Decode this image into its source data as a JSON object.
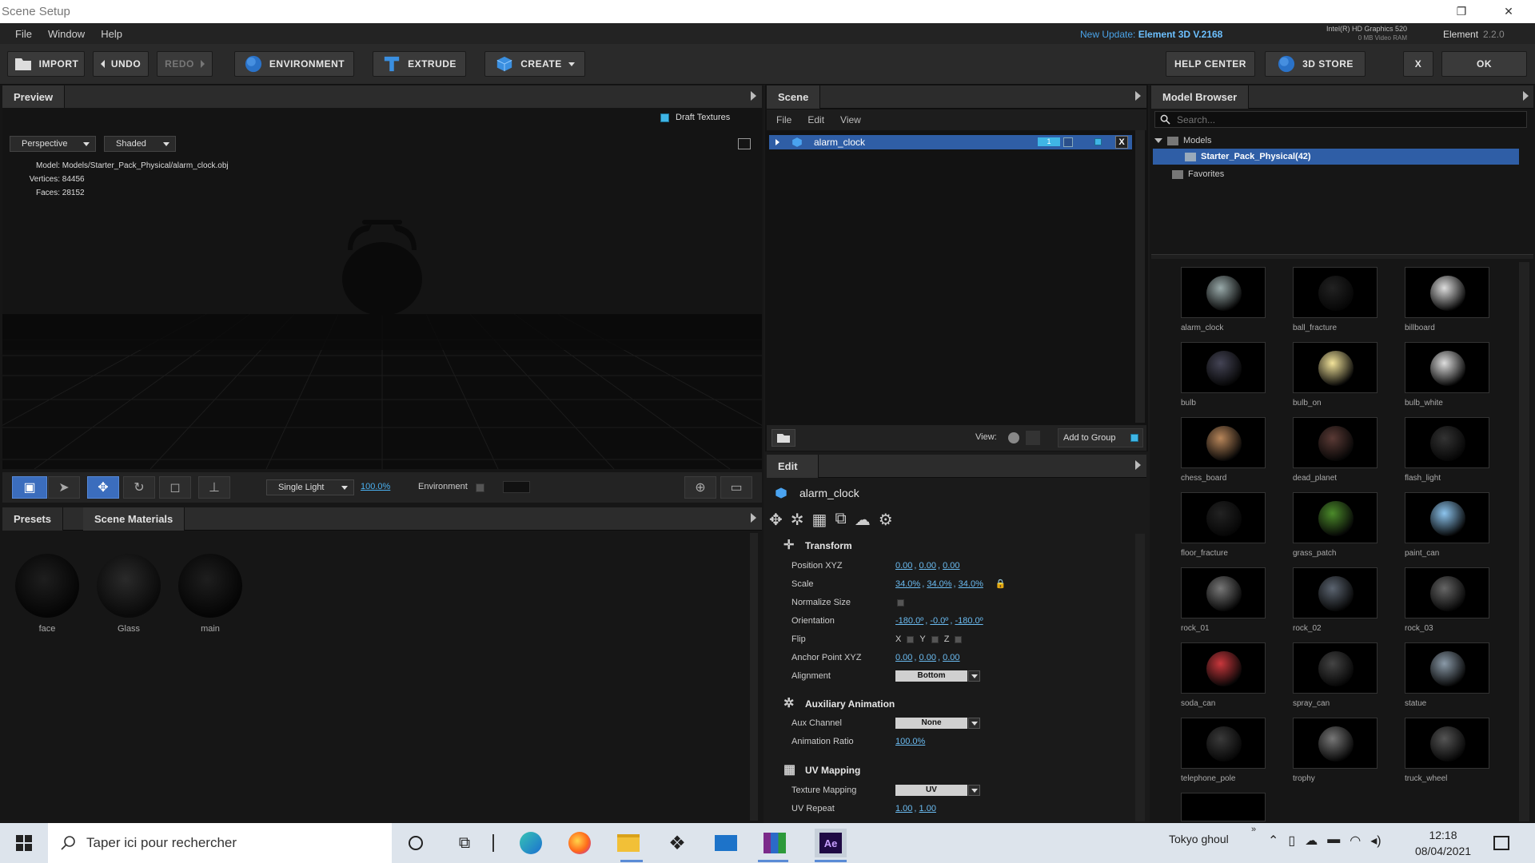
{
  "window": {
    "title": "Scene Setup",
    "restore": "❐",
    "close": "✕"
  },
  "menu": {
    "file": "File",
    "window": "Window",
    "help": "Help"
  },
  "update": {
    "prefix": "New Update:",
    "version": "Element 3D V.2168"
  },
  "gpu": {
    "name": "Intel(R) HD Graphics 520",
    "ram": "0 MB Video RAM"
  },
  "app": {
    "name": "Element",
    "version": "2.2.0"
  },
  "toolbar": {
    "import": "IMPORT",
    "undo": "UNDO",
    "redo": "REDO",
    "environment": "ENVIRONMENT",
    "extrude": "EXTRUDE",
    "create": "CREATE",
    "help_center": "HELP CENTER",
    "store": "3D STORE",
    "close": "X",
    "ok": "OK"
  },
  "preview": {
    "tab": "Preview",
    "draft_textures": "Draft Textures",
    "camera": "Perspective",
    "shading": "Shaded",
    "model_label": "Model:",
    "model_path": "Models/Starter_Pack_Physical/alarm_clock.obj",
    "vertices_label": "Vertices:",
    "vertices": "84456",
    "faces_label": "Faces:",
    "faces": "28152"
  },
  "viewbar": {
    "light": "Single Light",
    "light_pct": "100.0%",
    "environment": "Environment"
  },
  "presets": {
    "tab_presets": "Presets",
    "tab_materials": "Scene Materials",
    "materials": [
      "face",
      "Glass",
      "main"
    ]
  },
  "scene": {
    "tab": "Scene",
    "menu": [
      "File",
      "Edit",
      "View"
    ],
    "item": "alarm_clock",
    "group_badge": "1",
    "view_label": "View:",
    "add_to_group": "Add to Group"
  },
  "edit": {
    "tab": "Edit",
    "object": "alarm_clock",
    "transform": "Transform",
    "rows": {
      "position": {
        "label": "Position XYZ",
        "values": [
          "0.00",
          "0.00",
          "0.00"
        ]
      },
      "scale": {
        "label": "Scale",
        "values": [
          "34.0%",
          "34.0%",
          "34.0%"
        ]
      },
      "normalize": {
        "label": "Normalize Size"
      },
      "orientation": {
        "label": "Orientation",
        "values": [
          "-180.0º",
          "-0.0º",
          "-180.0º"
        ]
      },
      "flip": {
        "label": "Flip",
        "axes": [
          "X",
          "Y",
          "Z"
        ]
      },
      "anchor": {
        "label": "Anchor Point XYZ",
        "values": [
          "0.00",
          "0.00",
          "0.00"
        ]
      },
      "alignment": {
        "label": "Alignment",
        "value": "Bottom"
      }
    },
    "aux": "Auxiliary Animation",
    "aux_channel": {
      "label": "Aux Channel",
      "value": "None"
    },
    "anim_ratio": {
      "label": "Animation Ratio",
      "value": "100.0%"
    },
    "uv": "UV Mapping",
    "texture_mapping": {
      "label": "Texture Mapping",
      "value": "UV"
    },
    "uv_repeat": {
      "label": "UV Repeat",
      "values": [
        "1.00",
        "1.00"
      ]
    }
  },
  "browser": {
    "tab": "Model Browser",
    "search_placeholder": "Search...",
    "tree": {
      "models": "Models",
      "pack": "Starter_Pack_Physical(42)",
      "favorites": "Favorites"
    },
    "models": [
      "alarm_clock",
      "ball_fracture",
      "billboard",
      "bulb",
      "bulb_on",
      "bulb_white",
      "chess_board",
      "dead_planet",
      "flash_light",
      "floor_fracture",
      "grass_patch",
      "paint_can",
      "rock_01",
      "rock_02",
      "rock_03",
      "soda_can",
      "spray_can",
      "statue",
      "telephone_pole",
      "trophy",
      "truck_wheel"
    ]
  },
  "taskbar": {
    "search": "Taper ici pour rechercher",
    "weather": "Tokyo ghoul",
    "time": "12:18",
    "date": "08/04/2021"
  },
  "colors": {
    "accent": "#3fb5e5",
    "selection": "#2f5ea6",
    "link": "#4ab0f0"
  }
}
